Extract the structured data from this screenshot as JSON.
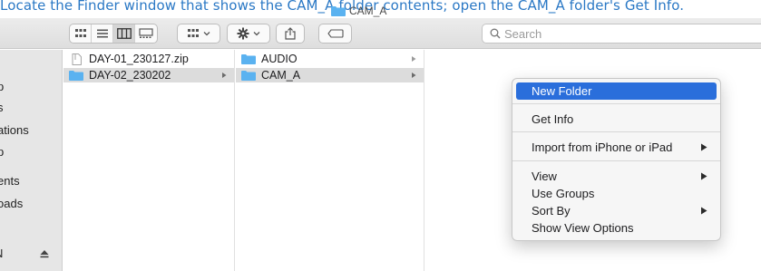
{
  "banner": {
    "text": "Locate the Finder window that shows the CAM_A folder contents; open the CAM_A folder's Get Info."
  },
  "window": {
    "title": "CAM_A"
  },
  "toolbar": {
    "view_buttons": [
      "icon-view",
      "list-view",
      "column-view",
      "gallery-view"
    ],
    "search_placeholder": "Search"
  },
  "sidebar": {
    "items": [
      "p",
      "s",
      "ations",
      "p",
      "ents",
      "oads"
    ],
    "device_label": "N"
  },
  "columns": {
    "col1": [
      {
        "label": "DAY-01_230127.zip",
        "icon": "zip-file-icon",
        "selected": false
      },
      {
        "label": "DAY-02_230202",
        "icon": "folder-icon",
        "selected": true
      }
    ],
    "col2": [
      {
        "label": "AUDIO",
        "icon": "folder-icon",
        "selected": false
      },
      {
        "label": "CAM_A",
        "icon": "folder-icon",
        "selected": true
      }
    ]
  },
  "context_menu": {
    "items": [
      {
        "label": "New Folder",
        "highlighted": true
      },
      {
        "label": "Get Info"
      },
      {
        "label": "Import from iPhone or iPad",
        "submenu": true
      },
      {
        "label": "View",
        "submenu": true
      },
      {
        "label": "Use Groups"
      },
      {
        "label": "Sort By",
        "submenu": true
      },
      {
        "label": "Show View Options"
      }
    ]
  },
  "colors": {
    "accent": "#2a6edb",
    "folder": "#5ab2f0",
    "banner_text": "#2a78c5"
  }
}
